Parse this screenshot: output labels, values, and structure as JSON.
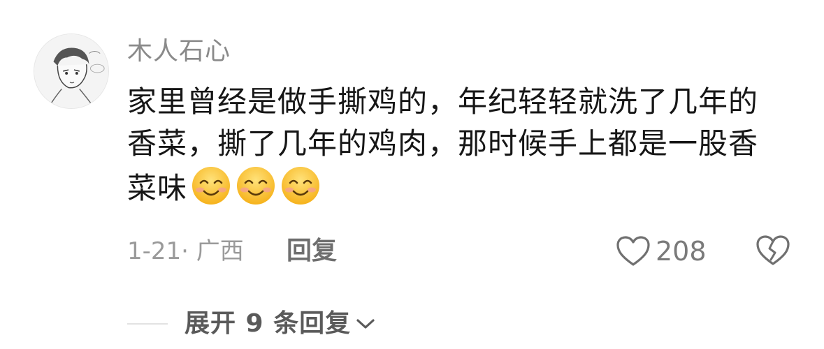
{
  "comment": {
    "username": "木人石心",
    "text": "家里曾经是做手撕鸡的，年纪轻轻就洗了几年的香菜，撕了几年的鸡肉，那时候手上都是一股香菜味",
    "emojis": [
      "smiling-face-emoji",
      "smiling-face-emoji",
      "smiling-face-emoji"
    ],
    "date_location": "1-21· 广西",
    "reply_label": "回复",
    "like_count": "208",
    "expand_label": "展开 9 条回复"
  },
  "colors": {
    "username": "#8a8a8a",
    "body_text": "#161616",
    "meta_text": "#9a9a9a",
    "icon_stroke": "#707070",
    "emoji_face": "#ffd23f"
  }
}
